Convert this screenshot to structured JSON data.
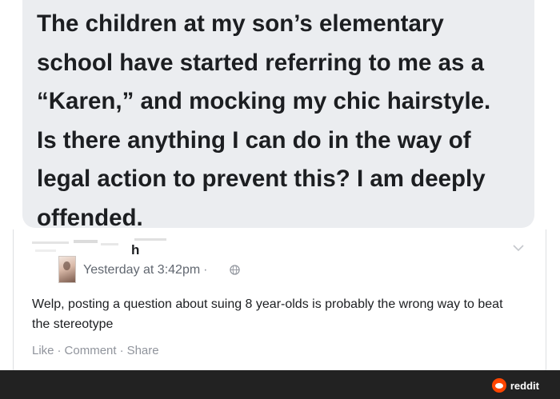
{
  "post": {
    "text": "The children at my son’s elementary\nschool have started referring to me as a\n“Karen,” and mocking my chic hairstyle.\nIs there anything I can do in the way of\nlegal action to prevent this? I am deeply\noffended."
  },
  "comment": {
    "author_fragment": "h",
    "timestamp": "Yesterday at 3:42pm",
    "timestamp_separator": "·",
    "privacy_icon": "globe-icon",
    "menu_icon": "chevron-down-icon",
    "text": "Welp, posting a question about suing 8 year-olds is probably the wrong way to beat the stereotype",
    "actions": {
      "like": "Like",
      "comment": "Comment",
      "share": "Share",
      "separator": "·"
    }
  },
  "watermark": {
    "label": "reddit",
    "icon": "reddit-icon"
  }
}
